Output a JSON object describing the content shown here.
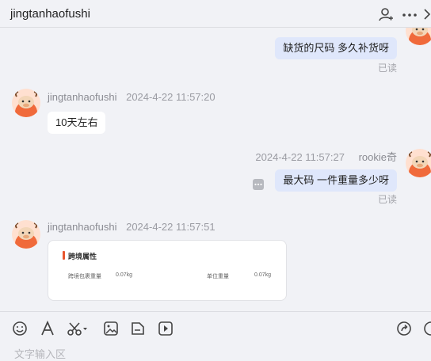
{
  "header": {
    "title": "jingtanhaofushi",
    "icons": [
      "add-user-icon",
      "more-horizontal-icon",
      "expand-icon"
    ]
  },
  "messages": [
    {
      "direction": "out",
      "text": "缺货的尺码  多久补货呀",
      "status": "已读"
    },
    {
      "direction": "in",
      "sender": "jingtanhaofushi",
      "time": "2024-4-22 11:57:20",
      "text": "10天左右"
    },
    {
      "direction": "out",
      "sender": "rookie奇",
      "time": "2024-4-22 11:57:27",
      "text": "最大码  一件重量多少呀",
      "status": "已读"
    },
    {
      "direction": "in",
      "sender": "jingtanhaofushi",
      "time": "2024-4-22 11:57:51",
      "card": {
        "title": "跨境属性",
        "rows": [
          {
            "label": "跨境包裹重量",
            "value": "0.07kg"
          },
          {
            "label": "单位重量",
            "value": "0.07kg"
          }
        ]
      }
    }
  ],
  "toolbar": {
    "icons": [
      "emoji-icon",
      "font-icon",
      "scissors-icon",
      "image-icon",
      "file-icon",
      "video-icon",
      "share-icon",
      "quick-reply-icon"
    ]
  },
  "input": {
    "placeholder": "文字输入区"
  },
  "colors": {
    "bubble_out": "#dfe7fb",
    "bubble_in": "#ffffff",
    "background": "#f1f2f6",
    "accent": "#e8562f"
  }
}
